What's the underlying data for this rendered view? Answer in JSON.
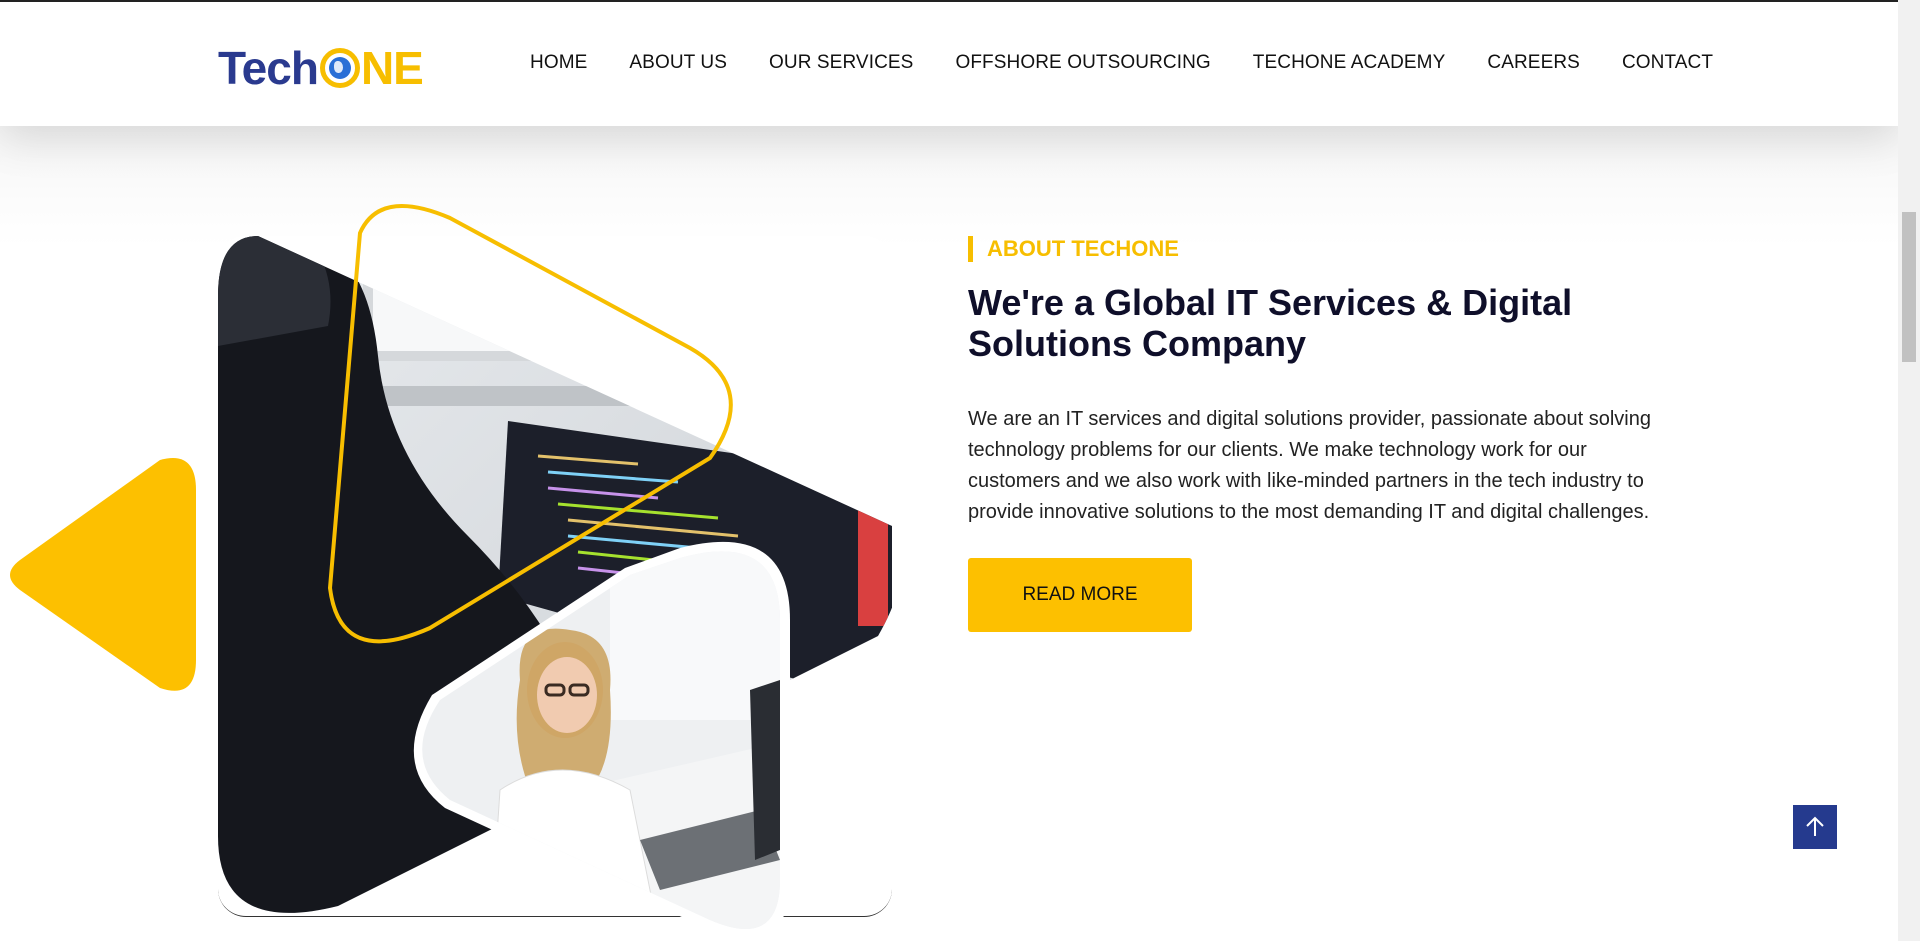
{
  "brand": {
    "name_part1": "Tech",
    "name_part2": "NE",
    "brand_color": "#2a3a8f",
    "accent_color": "#f7be00"
  },
  "nav": {
    "items": [
      {
        "label": "HOME"
      },
      {
        "label": "ABOUT US"
      },
      {
        "label": "OUR SERVICES"
      },
      {
        "label": "OFFSHORE OUTSOURCING"
      },
      {
        "label": "TECHONE ACADEMY"
      },
      {
        "label": "CAREERS"
      },
      {
        "label": "CONTACT"
      }
    ]
  },
  "about": {
    "eyebrow": "ABOUT TECHONE",
    "heading": "We're a Global IT Services & Digital Solutions Company",
    "paragraph": "We are an IT services and digital solutions provider, passionate about solving technology problems for our clients. We make technology work for our customers and we also work with like-minded partners in the tech industry to provide innovative solutions to the most demanding IT and digital challenges.",
    "cta_label": "READ MORE"
  },
  "icons": {
    "back_to_top": "arrow-up-icon",
    "logo_globe": "globe-icon"
  },
  "colors": {
    "cta": "#fdc000",
    "back_to_top": "#253a8e",
    "heading": "#0f0f2a"
  }
}
